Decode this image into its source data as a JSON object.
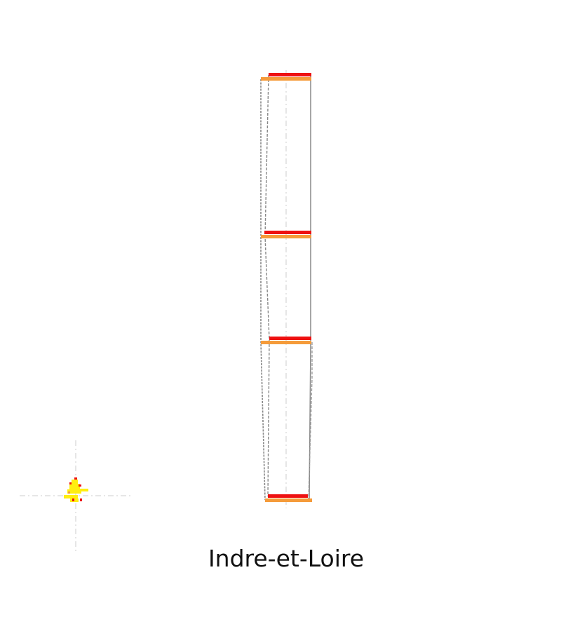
{
  "caption": "Indre-et-Loire",
  "colors": {
    "red": "#ee1111",
    "orange": "#f59b3a",
    "yellow": "#ffee11",
    "outline": "#888888",
    "axis": "#cccccc"
  }
}
